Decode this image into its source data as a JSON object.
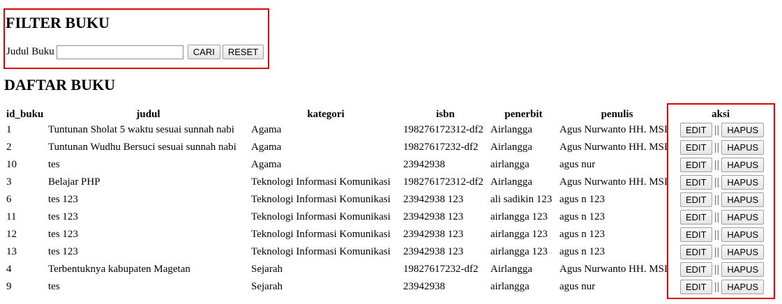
{
  "filter": {
    "title": "FILTER BUKU",
    "label": "Judul Buku",
    "input_value": "",
    "search_label": "CARI",
    "reset_label": "RESET"
  },
  "list": {
    "title": "DAFTAR BUKU",
    "columns": [
      "id_buku",
      "judul",
      "kategori",
      "isbn",
      "penerbit",
      "penulis",
      "aksi"
    ],
    "edit_label": "EDIT",
    "separator": "||",
    "delete_label": "HAPUS",
    "rows": [
      [
        "1",
        "Tuntunan Sholat 5 waktu sesuai sunnah nabi",
        "Agama",
        "198276172312-df2",
        "Airlangga",
        "Agus Nurwanto HH. MSI"
      ],
      [
        "2",
        "Tuntunan Wudhu Bersuci sesuai sunnah nabi",
        "Agama",
        "19827617232-df2",
        "Airlangga",
        "Agus Nurwanto HH. MSI"
      ],
      [
        "10",
        "tes",
        "Agama",
        "23942938",
        "airlangga",
        "agus nur"
      ],
      [
        "3",
        "Belajar PHP",
        "Teknologi Informasi Komunikasi",
        "198276172312-df2",
        "Airlangga",
        "Agus Nurwanto HH. MSI"
      ],
      [
        "6",
        "tes 123",
        "Teknologi Informasi Komunikasi",
        "23942938 123",
        "ali sadikin 123",
        "agus n 123"
      ],
      [
        "11",
        "tes 123",
        "Teknologi Informasi Komunikasi",
        "23942938 123",
        "airlangga 123",
        "agus n 123"
      ],
      [
        "12",
        "tes 123",
        "Teknologi Informasi Komunikasi",
        "23942938 123",
        "airlangga 123",
        "agus n 123"
      ],
      [
        "13",
        "tes 123",
        "Teknologi Informasi Komunikasi",
        "23942938 123",
        "airlangga 123",
        "agus n 123"
      ],
      [
        "4",
        "Terbentuknya kabupaten Magetan",
        "Sejarah",
        "19827617232-df2",
        "Airlangga",
        "Agus Nurwanto HH. MSI"
      ],
      [
        "9",
        "tes",
        "Sejarah",
        "23942938",
        "airlangga",
        "agus nur"
      ]
    ]
  },
  "colors": {
    "highlight_border": "#e00000"
  }
}
